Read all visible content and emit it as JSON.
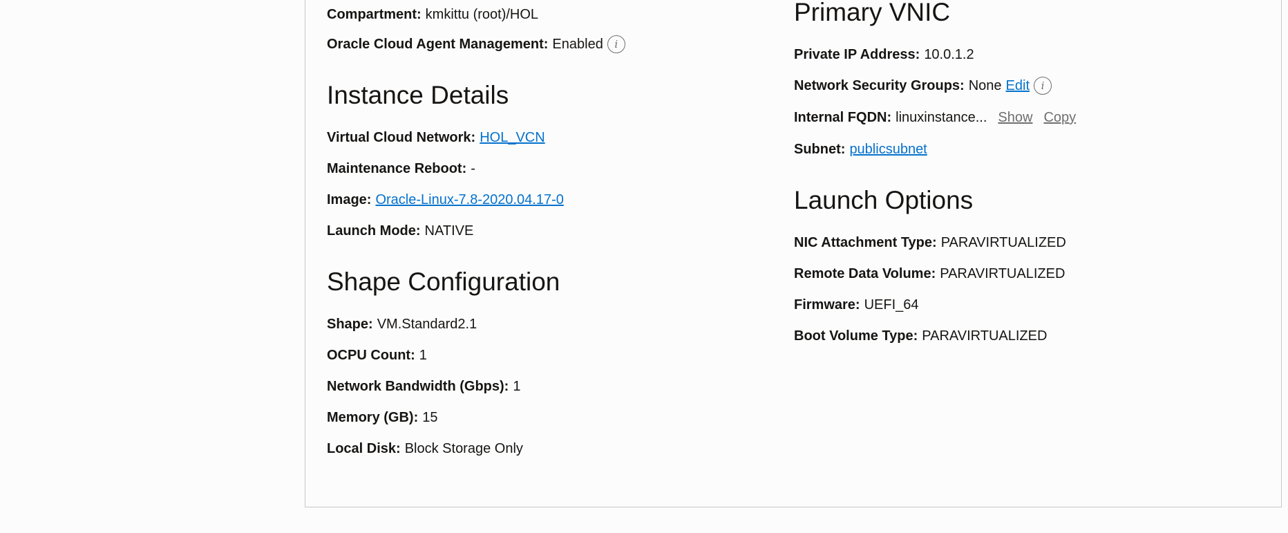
{
  "left": {
    "compartment": {
      "label": "Compartment:",
      "value": "kmkittu (root)/HOL"
    },
    "agent": {
      "label": "Oracle Cloud Agent Management:",
      "value": "Enabled",
      "icon": "info-icon"
    },
    "instance_details": {
      "title": "Instance Details",
      "vcn": {
        "label": "Virtual Cloud Network:",
        "value": "HOL_VCN"
      },
      "maintenance": {
        "label": "Maintenance Reboot:",
        "value": "-"
      },
      "image": {
        "label": "Image:",
        "value": "Oracle-Linux-7.8-2020.04.17-0"
      },
      "launch_mode": {
        "label": "Launch Mode:",
        "value": "NATIVE"
      }
    },
    "shape_config": {
      "title": "Shape Configuration",
      "shape": {
        "label": "Shape:",
        "value": "VM.Standard2.1"
      },
      "ocpu": {
        "label": "OCPU Count:",
        "value": "1"
      },
      "bandwidth": {
        "label": "Network Bandwidth (Gbps):",
        "value": "1"
      },
      "memory": {
        "label": "Memory (GB):",
        "value": "15"
      },
      "local_disk": {
        "label": "Local Disk:",
        "value": "Block Storage Only"
      }
    }
  },
  "right": {
    "primary_vnic": {
      "title": "Primary VNIC",
      "private_ip": {
        "label": "Private IP Address:",
        "value": "10.0.1.2"
      },
      "nsg": {
        "label": "Network Security Groups:",
        "value": "None",
        "edit": "Edit",
        "icon": "info-icon"
      },
      "fqdn": {
        "label": "Internal FQDN:",
        "value": "linuxinstance...",
        "show": "Show",
        "copy": "Copy"
      },
      "subnet": {
        "label": "Subnet:",
        "value": "publicsubnet"
      }
    },
    "launch_options": {
      "title": "Launch Options",
      "nic": {
        "label": "NIC Attachment Type:",
        "value": "PARAVIRTUALIZED"
      },
      "remote_volume": {
        "label": "Remote Data Volume:",
        "value": "PARAVIRTUALIZED"
      },
      "firmware": {
        "label": "Firmware:",
        "value": "UEFI_64"
      },
      "boot_volume": {
        "label": "Boot Volume Type:",
        "value": "PARAVIRTUALIZED"
      }
    }
  },
  "colors": {
    "link": "#0572ce",
    "muted_link": "#6f6f6f",
    "text": "#161513",
    "border": "#c7c7c7"
  }
}
